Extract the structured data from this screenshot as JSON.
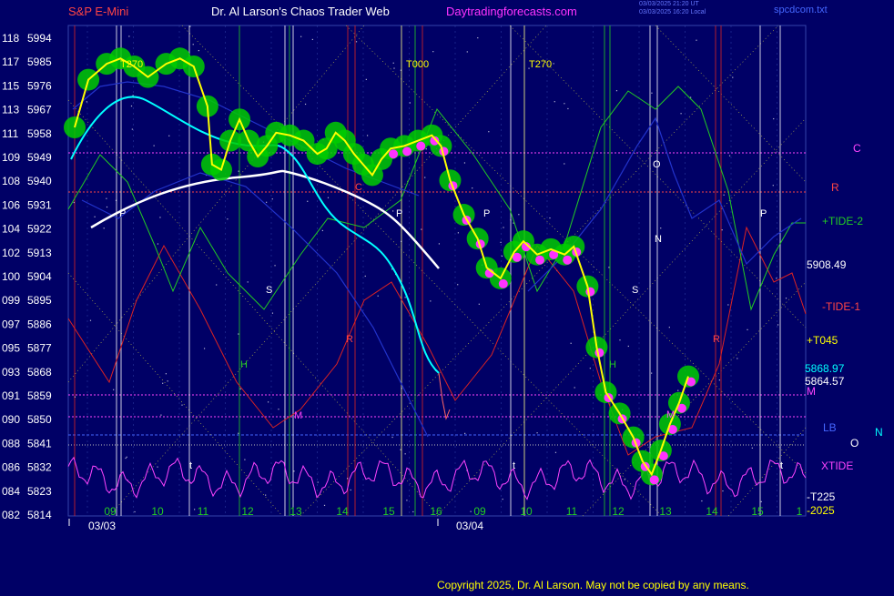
{
  "header": {
    "left": "S&P E-Mini",
    "center": "Dr. Al Larson's Chaos Trader Web",
    "site": "Daytradingforecasts.com",
    "stamp1": "03/03/2025 21:20 UT",
    "stamp2": "03/03/2025 16:20 Local",
    "file": "spcdcom.txt"
  },
  "copyright": "Copyright 2025, Dr. Al Larson. May not be copied by any means.",
  "colors": {
    "background": "#000066",
    "price": "#ffff00",
    "fast_ma": "#00ffff",
    "slow_ma": "#ffffff",
    "glow": "#00cc00",
    "magenta_dots": "#ff33ff",
    "tide_green": "#22cc22",
    "tide_red": "#dd2222",
    "xtide": "#ff44ff"
  },
  "chart_data": {
    "type": "line",
    "title": "S&P E-Mini",
    "y_axis": {
      "price_ticks": [
        "5994",
        "5985",
        "5976",
        "5967",
        "5958",
        "5949",
        "5940",
        "5931",
        "5922",
        "5913",
        "5904",
        "5895",
        "5886",
        "5877",
        "5868",
        "5859",
        "5850",
        "5841",
        "5832",
        "5823",
        "5814"
      ],
      "index_ticks": [
        "118",
        "117",
        "115",
        "113",
        "111",
        "109",
        "108",
        "106",
        "104",
        "102",
        "100",
        "099",
        "097",
        "095",
        "093",
        "091",
        "090",
        "088",
        "086",
        "084",
        "082"
      ],
      "ylim": [
        5814,
        5994
      ]
    },
    "x_axis": {
      "hour_labels": [
        "09",
        "10",
        "11",
        "12",
        "13",
        "14",
        "15",
        "16",
        "09",
        "10",
        "11",
        "12",
        "13",
        "14",
        "15",
        "1"
      ],
      "date_labels": [
        "03/03",
        "03/04"
      ]
    },
    "series": [
      {
        "name": "",
        "points": [
          [
            0,
            5960
          ],
          [
            0.3,
            5978
          ],
          [
            0.7,
            5984
          ],
          [
            1.0,
            5986
          ],
          [
            1.3,
            5983
          ],
          [
            1.6,
            5979
          ],
          [
            2.0,
            5984
          ],
          [
            2.3,
            5986
          ],
          [
            2.6,
            5983
          ],
          [
            2.9,
            5968
          ],
          [
            3.0,
            5946
          ],
          [
            3.2,
            5944
          ],
          [
            3.4,
            5955
          ],
          [
            3.6,
            5963
          ],
          [
            3.8,
            5955
          ],
          [
            4.0,
            5949
          ],
          [
            4.2,
            5953
          ],
          [
            4.4,
            5958
          ],
          [
            4.7,
            5957
          ],
          [
            5.0,
            5955
          ],
          [
            5.3,
            5950
          ],
          [
            5.5,
            5952
          ],
          [
            5.7,
            5958
          ],
          [
            5.9,
            5955
          ],
          [
            6.1,
            5950
          ],
          [
            6.3,
            5946
          ],
          [
            6.5,
            5942
          ],
          [
            6.7,
            5948
          ],
          [
            6.9,
            5952
          ],
          [
            7.2,
            5953
          ],
          [
            7.5,
            5955
          ],
          [
            7.8,
            5957
          ],
          [
            8.0,
            5953
          ],
          [
            8.2,
            5940
          ],
          [
            8.5,
            5927
          ],
          [
            8.8,
            5918
          ],
          [
            9.0,
            5907
          ],
          [
            9.3,
            5903
          ],
          [
            9.6,
            5913
          ],
          [
            9.8,
            5917
          ],
          [
            10.1,
            5912
          ],
          [
            10.4,
            5914
          ],
          [
            10.7,
            5912
          ],
          [
            10.9,
            5915
          ],
          [
            11.2,
            5900
          ],
          [
            11.4,
            5877
          ],
          [
            11.6,
            5860
          ],
          [
            11.9,
            5852
          ],
          [
            12.2,
            5843
          ],
          [
            12.4,
            5834
          ],
          [
            12.6,
            5829
          ],
          [
            12.8,
            5838
          ],
          [
            13.0,
            5848
          ],
          [
            13.2,
            5856
          ],
          [
            13.4,
            5866
          ]
        ]
      }
    ],
    "level_labels": [
      "5908.49",
      "5868.97",
      "5864.57"
    ],
    "right_labels": [
      "C",
      "R",
      "+TIDE-2",
      "-TIDE-1",
      "+T045",
      "M",
      "LB",
      "O",
      "N",
      "XTIDE",
      "-T225",
      "-2025"
    ],
    "cycle_labels": [
      "T270",
      "T000",
      "T270",
      "P",
      "P",
      "P",
      "P",
      "S",
      "S",
      "H",
      "H",
      "M",
      "M",
      "R",
      "R",
      "C",
      "O",
      "N",
      "t",
      "t",
      "t"
    ]
  }
}
